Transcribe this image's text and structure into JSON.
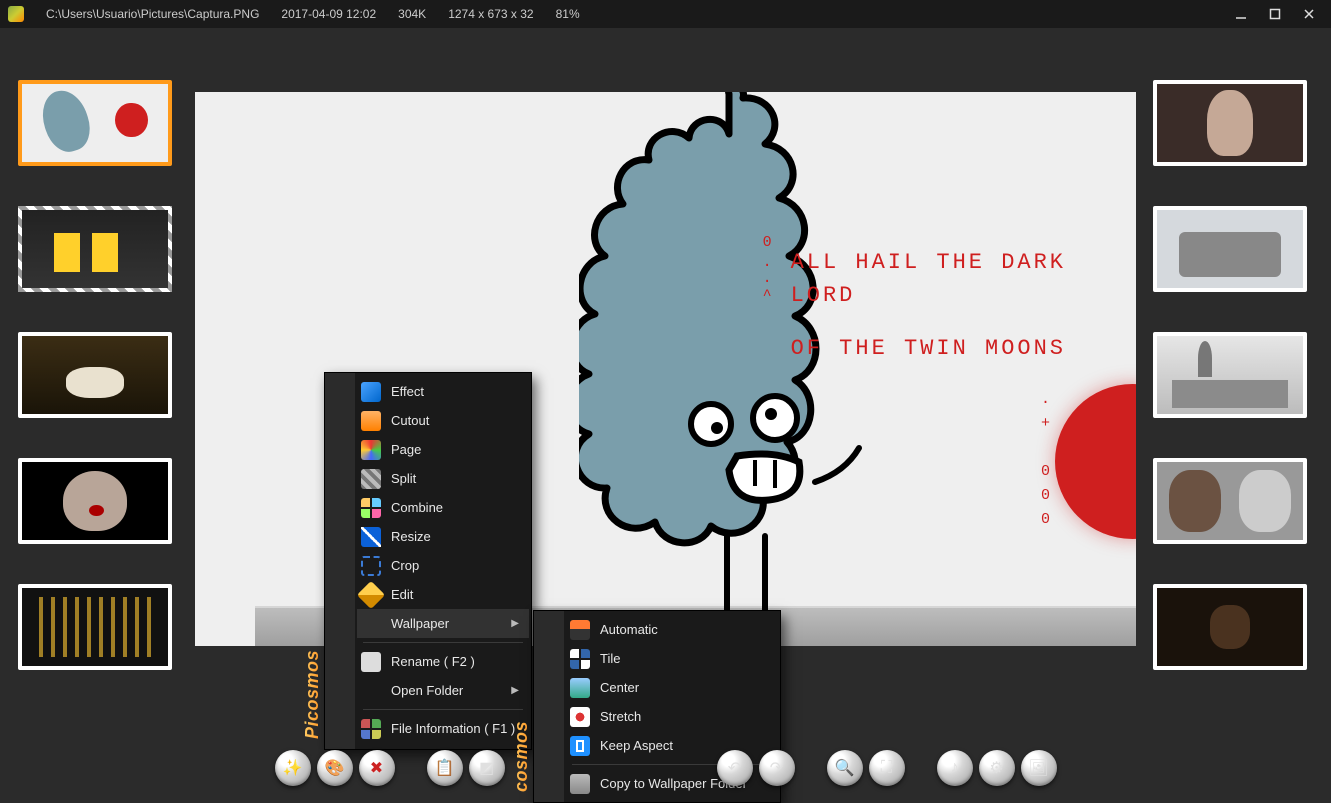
{
  "titlebar": {
    "path": "C:\\Users\\Usuario\\Pictures\\Captura.PNG",
    "datetime": "2017-04-09 12:02",
    "size": "304K",
    "dimensions": "1274 x 673 x 32",
    "zoom": "81%"
  },
  "brand": "Picosmos",
  "main_image": {
    "caption_markers_top": "0",
    "caption_line1": "ALL HAIL THE DARK",
    "caption_line2": "LORD",
    "caption_line3": "OF THE TWIN MOONS",
    "caption_markers_mid": ". . ^",
    "caption_markers_bot1": ". +",
    "caption_markers_bot2": "0 0 0"
  },
  "context_menu": {
    "items": [
      {
        "label": "Effect",
        "icon": "effect"
      },
      {
        "label": "Cutout",
        "icon": "cutout"
      },
      {
        "label": "Page",
        "icon": "page"
      },
      {
        "label": "Split",
        "icon": "split"
      },
      {
        "label": "Combine",
        "icon": "combine"
      },
      {
        "label": "Resize",
        "icon": "resize"
      },
      {
        "label": "Crop",
        "icon": "crop"
      },
      {
        "label": "Edit",
        "icon": "edit"
      },
      {
        "label": "Wallpaper",
        "submenu": true,
        "highlighted": true
      },
      {
        "divider": true
      },
      {
        "label": "Rename ( F2 )",
        "icon": "rename"
      },
      {
        "label": "Open Folder",
        "submenu": true
      },
      {
        "divider": true
      },
      {
        "label": "File Information ( F1 )",
        "icon": "multi"
      }
    ],
    "wallpaper_submenu": [
      {
        "label": "Automatic",
        "icon": "auto"
      },
      {
        "label": "Tile",
        "icon": "tile"
      },
      {
        "label": "Center",
        "icon": "center"
      },
      {
        "label": "Stretch",
        "icon": "stretch"
      },
      {
        "label": "Keep Aspect",
        "icon": "keep"
      },
      {
        "divider": true
      },
      {
        "label": "Copy to Wallpaper Folder",
        "icon": "copy"
      }
    ]
  },
  "thumbnails": {
    "left": [
      "current",
      "still-2",
      "still-3",
      "still-4",
      "still-5"
    ],
    "right": [
      "still-6",
      "still-7",
      "still-8",
      "still-9",
      "still-10"
    ]
  },
  "toolbar_buttons": [
    "effects",
    "color",
    "delete",
    "",
    "copy",
    "crop",
    "",
    "rotate-left",
    "rotate-right",
    "",
    "zoom-in",
    "zoom-fit",
    "",
    "music",
    "settings",
    "wallpaper"
  ]
}
